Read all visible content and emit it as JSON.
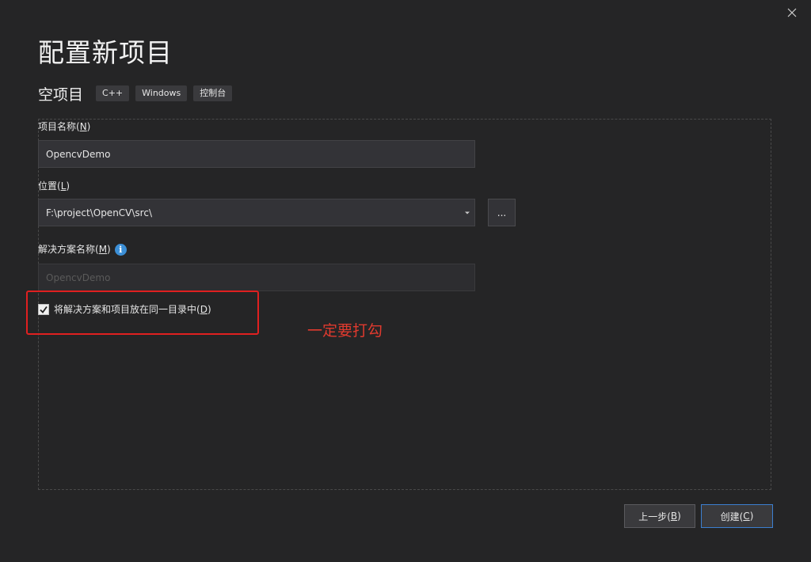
{
  "dialog": {
    "title": "配置新项目"
  },
  "template": {
    "name": "空项目",
    "tags": [
      "C++",
      "Windows",
      "控制台"
    ]
  },
  "form": {
    "project_name": {
      "label": "项目名称(N)",
      "label_prefix": "项目名称(",
      "label_key": "N",
      "label_suffix": ")",
      "value": "OpencvDemo"
    },
    "location": {
      "label_prefix": "位置(",
      "label_key": "L",
      "label_suffix": ")",
      "value": "F:\\project\\OpenCV\\src\\"
    },
    "browse_label": "...",
    "solution_name": {
      "label_prefix": "解决方案名称(",
      "label_key": "M",
      "label_suffix": ")",
      "value": "OpencvDemo"
    },
    "same_dir": {
      "label_prefix": "将解决方案和项目放在同一目录中(",
      "label_key": "D",
      "label_suffix": ")",
      "checked": true
    }
  },
  "annotation": {
    "text": "一定要打勾",
    "color": "#e03a2e"
  },
  "buttons": {
    "back": {
      "prefix": "上一步(",
      "key": "B",
      "suffix": ")"
    },
    "create": {
      "prefix": "创建(",
      "key": "C",
      "suffix": ")"
    }
  },
  "colors": {
    "accent": "#3c7fd0",
    "annotation": "#e02020",
    "info": "#3c8fd6"
  },
  "icons": {
    "close": "close-icon",
    "info": "info-icon",
    "check": "check-icon",
    "dropdown": "chevron-down-icon"
  }
}
